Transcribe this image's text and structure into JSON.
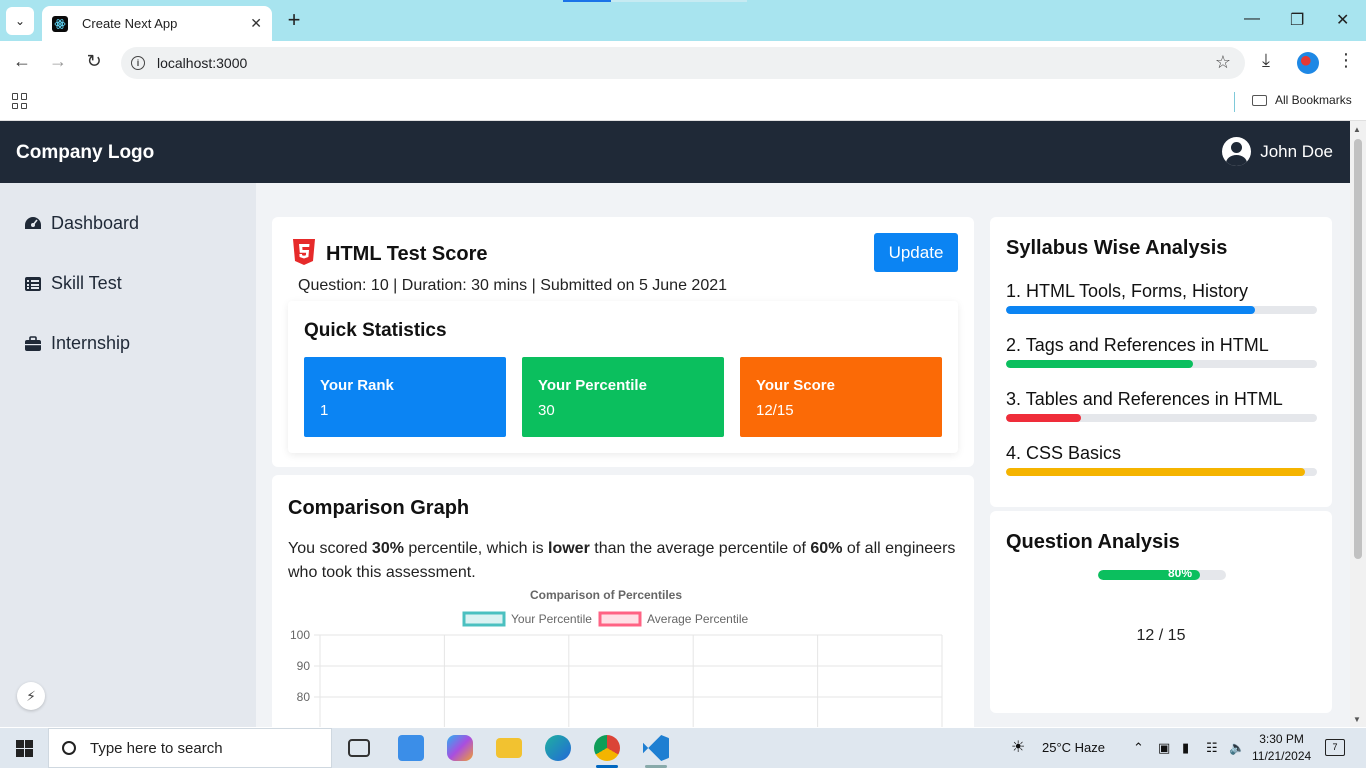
{
  "browser": {
    "tab_title": "Create Next App",
    "url": "localhost:3000",
    "bookmarks_label": "All Bookmarks"
  },
  "navbar": {
    "logo": "Company Logo",
    "user_name": "John Doe"
  },
  "sidebar": {
    "items": [
      {
        "label": "Dashboard",
        "icon": "dashboard-icon"
      },
      {
        "label": "Skill Test",
        "icon": "list-icon"
      },
      {
        "label": "Internship",
        "icon": "briefcase-icon"
      }
    ]
  },
  "score_card": {
    "title": "HTML Test Score",
    "update_label": "Update",
    "meta": "Question: 10 | Duration: 30 mins | Submitted on 5 June 2021"
  },
  "quick_stats": {
    "title": "Quick Statistics",
    "stats": [
      {
        "label": "Your Rank",
        "value": "1",
        "color": "#0b84f3"
      },
      {
        "label": "Your Percentile",
        "value": "30",
        "color": "#0bbf5e"
      },
      {
        "label": "Your Score",
        "value": "12/15",
        "color": "#fb6a06"
      }
    ]
  },
  "comparison": {
    "title": "Comparison Graph",
    "text_1": "You scored ",
    "text_bold_1": "30%",
    "text_2": " percentile, which is ",
    "text_bold_2": "lower",
    "text_3": " than the average percentile of ",
    "text_bold_3": "60%",
    "text_4": " of all engineers who took this assessment."
  },
  "chart_data": {
    "type": "line",
    "title": "Comparison of Percentiles",
    "series": [
      {
        "name": "Your Percentile",
        "color": "#4bc0c0"
      },
      {
        "name": "Average Percentile",
        "color": "#ff6384"
      }
    ],
    "y_ticks": [
      100,
      90,
      80
    ],
    "ylim": [
      0,
      100
    ],
    "legend_position": "top",
    "grid": true
  },
  "syllabus": {
    "title": "Syllabus Wise Analysis",
    "items": [
      {
        "label": "1. HTML Tools, Forms, History",
        "progress": 0.8,
        "color": "#0b84f3"
      },
      {
        "label": "2. Tags and References in HTML",
        "progress": 0.6,
        "color": "#0bbf5e"
      },
      {
        "label": "3. Tables and References in HTML",
        "progress": 0.24,
        "color": "#ef2d3a"
      },
      {
        "label": "4. CSS Basics",
        "progress": 0.96,
        "color": "#f5b400"
      }
    ]
  },
  "question_analysis": {
    "title": "Question Analysis",
    "percent_label": "80%",
    "progress": 0.8,
    "count": "12 / 15"
  },
  "taskbar": {
    "search_placeholder": "Type here to search",
    "weather": "25°C  Haze",
    "time": "3:30 PM",
    "date": "11/21/2024",
    "notification_count": "7"
  }
}
